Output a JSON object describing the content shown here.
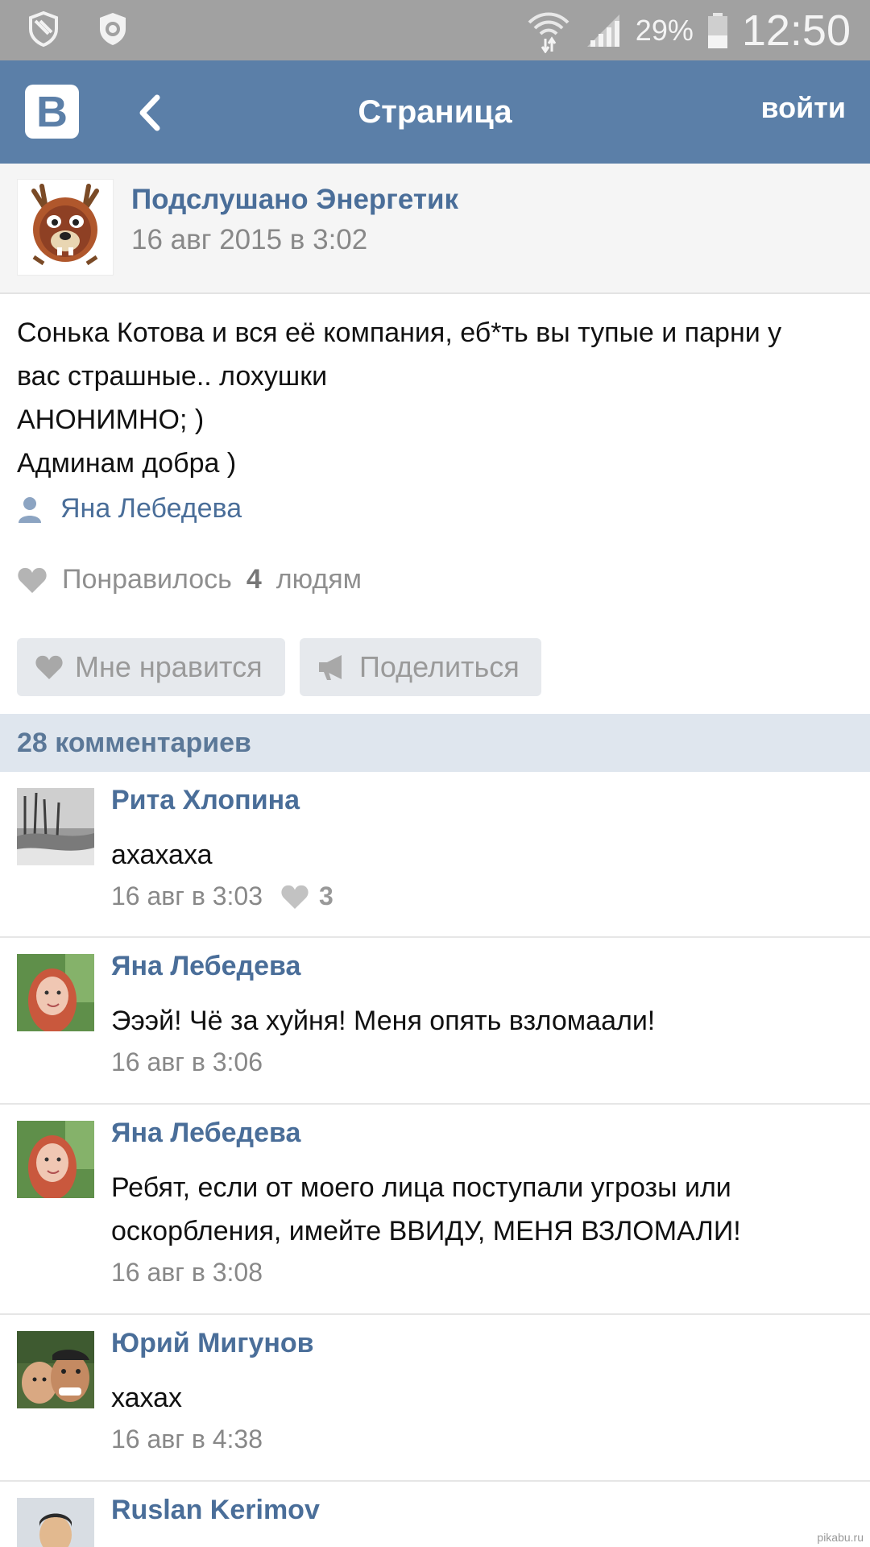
{
  "status_bar": {
    "battery_pct": "29%",
    "time": "12:50",
    "left_icons": [
      "shield-icon",
      "antivirus-icon"
    ],
    "right_icons": [
      "wifi-icon",
      "signal-icon",
      "battery-icon"
    ]
  },
  "app_bar": {
    "logo": "В",
    "title": "Страница",
    "login_label": "войти"
  },
  "post": {
    "group_name": "Подслушано Энергетик",
    "date": "16 авг 2015 в 3:02",
    "text_lines": [
      "Сонька Котова и вся её компания, еб*ть вы тупые и парни у",
      "вас страшные.. лохушки",
      "АНОНИМНО; )",
      "Админам добра )"
    ],
    "signer": "Яна Лебедева",
    "likes_prefix": "Понравилось",
    "likes_count": "4",
    "likes_suffix": "людям",
    "like_button_label": "Мне нравится",
    "share_button_label": "Поделиться"
  },
  "comments_header": "28 комментариев",
  "comments": [
    {
      "author": "Рита Хлопина",
      "text": [
        "ахахаха"
      ],
      "time": "16 авг в 3:03",
      "likes": "3"
    },
    {
      "author": "Яна Лебедева",
      "text": [
        "Эээй! Чё за хуйня! Меня опять взломаали!"
      ],
      "time": "16 авг в 3:06",
      "likes": ""
    },
    {
      "author": "Яна Лебедева",
      "text": [
        "Ребят, если от моего лица поступали угрозы или",
        "оскорбления, имейте ВВИДУ, МЕНЯ ВЗЛОМАЛИ!"
      ],
      "time": "16 авг в 3:08",
      "likes": ""
    },
    {
      "author": "Юрий Мигунов",
      "text": [
        "хахах"
      ],
      "time": "16 авг в 4:38",
      "likes": ""
    },
    {
      "author": "Ruslan Kerimov",
      "text": [],
      "time": "",
      "likes": ""
    }
  ],
  "watermark": "pikabu.ru"
}
